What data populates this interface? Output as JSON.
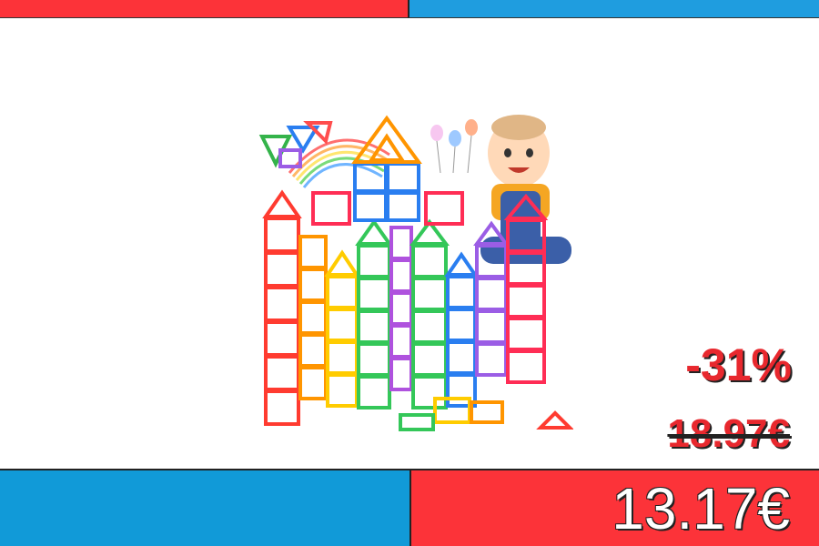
{
  "product": {
    "image_label": "magnetic building blocks toy set"
  },
  "pricing": {
    "discount": "-31%",
    "old_price": "18.97€",
    "new_price": "13.17€"
  },
  "colors": {
    "accent_red": "#fc3339",
    "accent_blue": "#1f9ddf"
  }
}
